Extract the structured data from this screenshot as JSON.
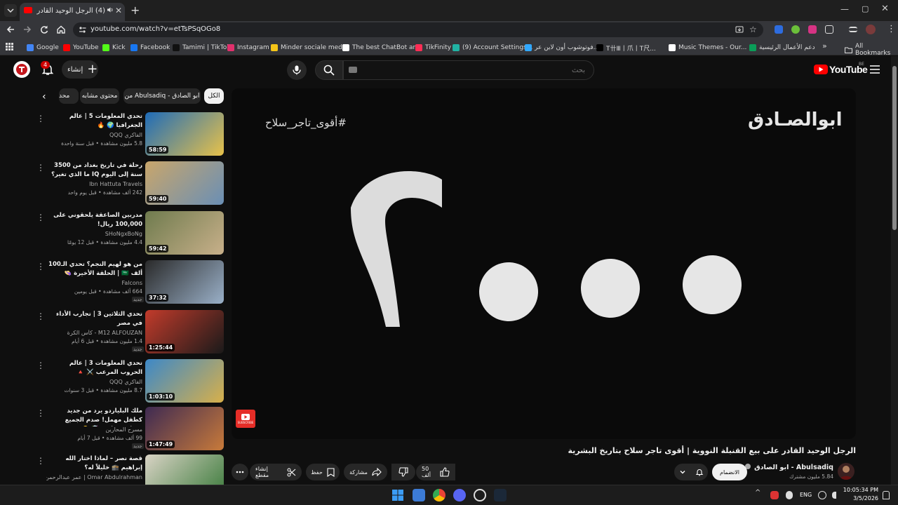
{
  "browser": {
    "tab_title": "(4) الرجل الوحيد القادر على بيع",
    "close_glyph": "✕",
    "new_tab_glyph": "+",
    "url": "youtube.com/watch?v=etTsPSqOGo8",
    "window": {
      "minimize": "—",
      "maximize": "▢",
      "close": "✕"
    },
    "star_glyph": "☆",
    "menu_glyph": "⋮"
  },
  "bookmarks": {
    "items": [
      {
        "label": "Google",
        "color": "#4285f4"
      },
      {
        "label": "YouTube",
        "color": "#ff0000"
      },
      {
        "label": "Kick",
        "color": "#53fc18"
      },
      {
        "label": "Facebook",
        "color": "#1877f2"
      },
      {
        "label": "Tamimi | TikTok",
        "color": "#111111"
      },
      {
        "label": "Instagram",
        "color": "#e1306c"
      },
      {
        "label": "Minder sociale medi...",
        "color": "#f5c518"
      },
      {
        "label": "The best ChatBot an...",
        "color": "#ffffff"
      },
      {
        "label": "TikFinity",
        "color": "#ff2d55"
      },
      {
        "label": "(9) Account Settings...",
        "color": "#21b3a4"
      },
      {
        "label": "فوتوشوب أون لاين عر...",
        "color": "#31a8ff"
      },
      {
        "label": "T卄Ⅲ丨爪丨T尺...",
        "color": "#000000"
      },
      {
        "label": "Music Themes - Our...",
        "color": "#ffffff"
      },
      {
        "label": "دعم الأعمال الرئيسية",
        "color": "#0a9d58"
      }
    ],
    "more_glyph": "»",
    "all_bookmarks": "All Bookmarks"
  },
  "yt_header": {
    "notification_count": "4",
    "create_label": "إنشاء",
    "create_glyph": "+",
    "search_placeholder": "بحث",
    "logo_text": "YouTube",
    "country_code": "BE"
  },
  "chips": {
    "items": [
      {
        "label": "الكل",
        "active": true
      },
      {
        "label": "من Abulsadiq - ابو الصادق",
        "active": false
      },
      {
        "label": "محتوى مشابه",
        "active": false
      },
      {
        "label": "محد",
        "active": false
      }
    ],
    "left_glyph": "‹"
  },
  "recommendations": [
    {
      "title": "تحدي المعلومات 5 | عالم الجغرافيا 🌍 🔥",
      "channel": "الفاكري QQQ",
      "meta": "5.8 مليون مشاهدة • قبل سنة واحدة",
      "duration": "58:59",
      "badge": ""
    },
    {
      "title": "رحلة في تاريخ بغداد من 3500 سنة إلى اليوم IQ ما الذي تغير؟",
      "channel": "Ibn Hattuta Travels",
      "meta": "242 ألف مشاهدة • قبل يوم واحد",
      "duration": "59:40",
      "badge": ""
    },
    {
      "title": "مدربين الصاعقة يلحقوني على 100,000 ريال!",
      "channel": "SHoNgxBoNg",
      "meta": "4.4 مليون مشاهدة • قبل 12 يومًا",
      "duration": "59:42",
      "badge": ""
    },
    {
      "title": "من هو لهيم النجم؟ تحدي الـ100 ألف 🇸🇦 | الحلقة الأخيرة 👒",
      "channel": "Falcons",
      "meta": "664 ألف مشاهدة • قبل يومين",
      "duration": "37:32",
      "badge": "جديد"
    },
    {
      "title": "تحدي الثلاثين 3 | تجارب الأداء في مصر",
      "channel": "M12 ALFOUZAN - كأس الكرة",
      "meta": "1.4 مليون مشاهدة • قبل 6 أيام",
      "duration": "1:25:44",
      "badge": "جديد"
    },
    {
      "title": "تحدي المعلومات 3 | عالم الحروب المرعب ⚔️ 🔺",
      "channel": "الفاكري QQQ",
      "meta": "8.7 مليون مشاهدة • قبل 3 سنوات",
      "duration": "1:03:10",
      "badge": ""
    },
    {
      "title": "ملك البلياردو يرد من جديد كطفل مهمل! صدم الجميع بمهارة خرافية 🤯 👴",
      "channel": "مسرح المحارين",
      "meta": "99 ألف مشاهدة • قبل 7 أيام",
      "duration": "1:47:49",
      "badge": "جديد"
    },
    {
      "title": "قصة نصر – لماذا اختار الله إبراهيم 🕋 خليلاً له؟",
      "channel": "Omar Abdulrahman | عمر عبدالرحمن",
      "meta": "",
      "duration": "",
      "badge": ""
    }
  ],
  "player": {
    "brand": "ابوالصـادق",
    "hashtag": "#أقوى_تاجر_سلاح",
    "art_number": "٢٠٠٠",
    "subscribe_label": "SUBSCRIBE"
  },
  "video": {
    "title": "الرجل الوحيد القادر على بيع القنبلة النووية | أقوى تاجر سلاح بتاريخ البشرية",
    "channel_name": "Abulsadiq - ابو الصادق",
    "channel_subs": "5.84 مليون مشترك",
    "join_label": "الانضمام",
    "like_count": "50 ألف",
    "share_label": "مشاركة",
    "save_label": "حفظ",
    "clip_label": "إنشاء مقطع"
  },
  "taskbar": {
    "time": "10:05:34 PM",
    "date": "3/5/2026",
    "lang": "ENG"
  },
  "colors": {
    "yt_red": "#ff0000",
    "background": "#0f0f0f",
    "chip_bg": "#272727"
  }
}
